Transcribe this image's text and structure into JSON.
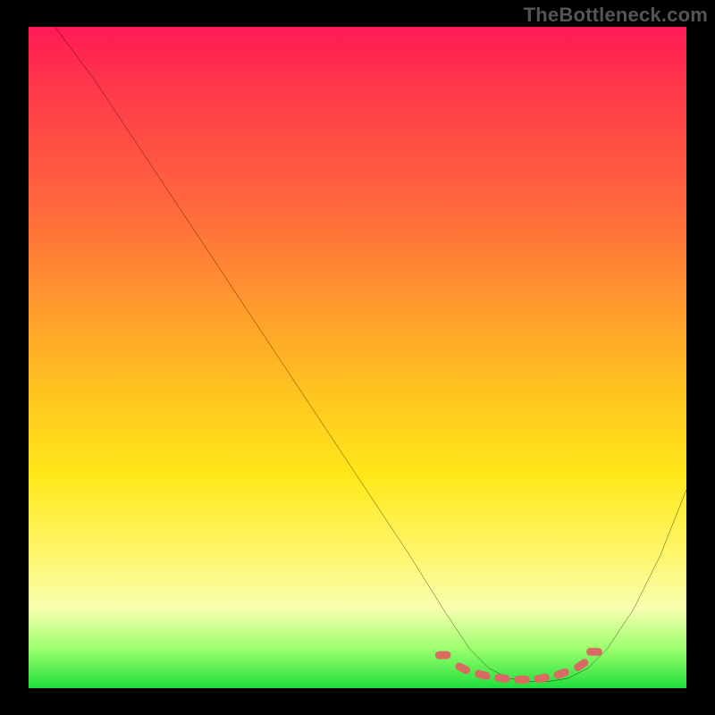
{
  "watermark": "TheBottleneck.com",
  "chart_data": {
    "type": "line",
    "title": "",
    "xlabel": "",
    "ylabel": "",
    "xlim": [
      0,
      100
    ],
    "ylim": [
      0,
      100
    ],
    "series": [
      {
        "name": "bottleneck-curve",
        "color": "#000000",
        "x": [
          4,
          10,
          18,
          26,
          34,
          42,
          50,
          58,
          63,
          67,
          70,
          73,
          76,
          79,
          82,
          85,
          88,
          92,
          96,
          100
        ],
        "y": [
          100,
          92,
          80,
          68,
          56,
          44,
          32,
          20,
          12,
          6,
          3,
          1.5,
          1,
          1,
          1.5,
          3,
          6,
          12,
          20,
          30
        ]
      }
    ],
    "highlight": {
      "name": "optimal-zone",
      "color": "#d96b63",
      "x": [
        63,
        66,
        69,
        72,
        75,
        78,
        81,
        84,
        86
      ],
      "y": [
        5,
        3,
        2,
        1.5,
        1.3,
        1.5,
        2.2,
        3.5,
        5.5
      ]
    },
    "gradient_stops": [
      {
        "pos": 0,
        "color": "#ff1a55"
      },
      {
        "pos": 10,
        "color": "#ff3a4a"
      },
      {
        "pos": 28,
        "color": "#ff6a3c"
      },
      {
        "pos": 42,
        "color": "#ff9a2e"
      },
      {
        "pos": 56,
        "color": "#ffc61f"
      },
      {
        "pos": 68,
        "color": "#ffe81a"
      },
      {
        "pos": 80,
        "color": "#fff66e"
      },
      {
        "pos": 88,
        "color": "#f7ffb0"
      },
      {
        "pos": 94,
        "color": "#9cff6e"
      },
      {
        "pos": 100,
        "color": "#1fdf3a"
      }
    ]
  }
}
